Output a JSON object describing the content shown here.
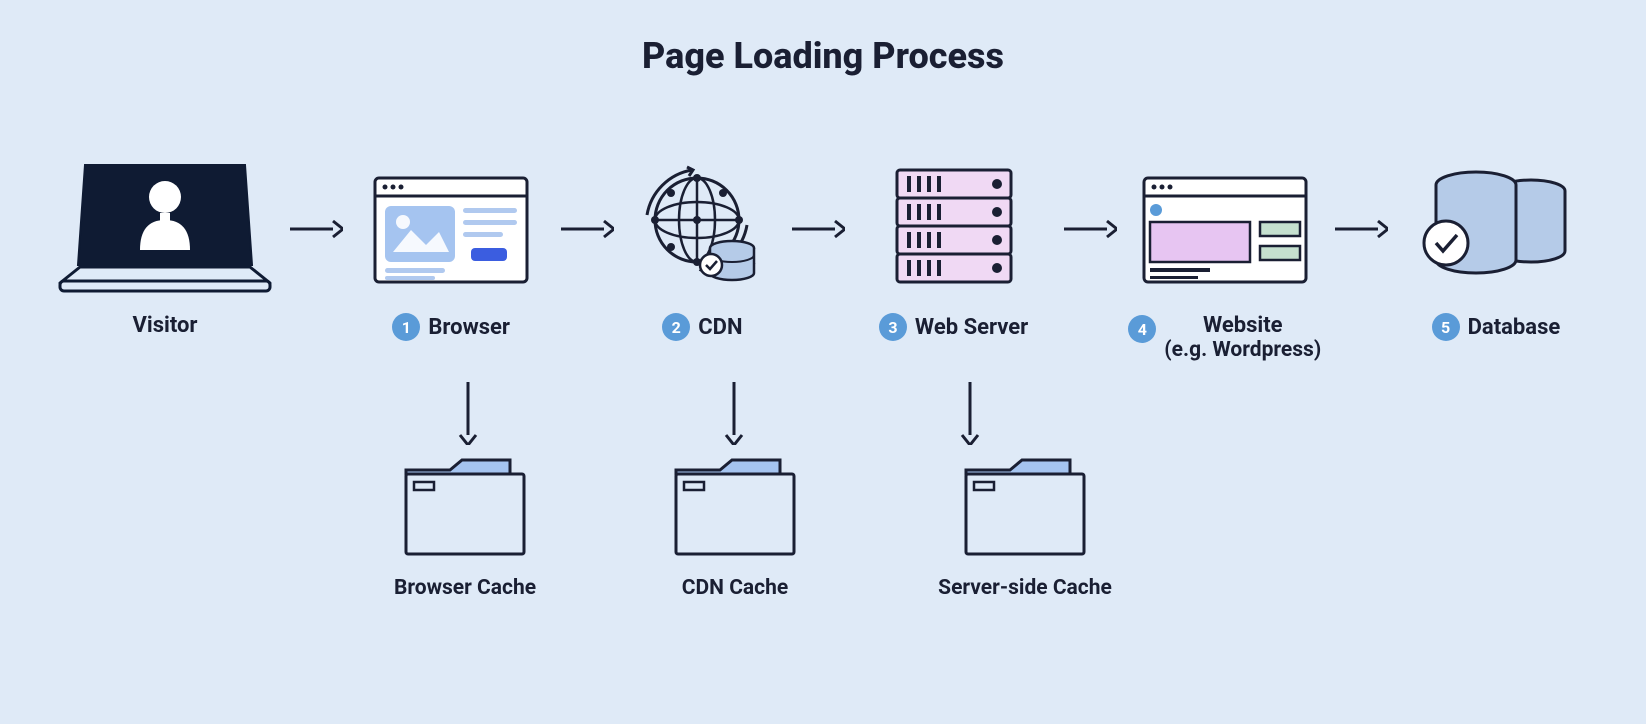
{
  "title": "Page Loading Process",
  "nodes": {
    "visitor": {
      "label": "Visitor"
    },
    "browser": {
      "num": "1",
      "label": "Browser"
    },
    "cdn": {
      "num": "2",
      "label": "CDN"
    },
    "webserver": {
      "num": "3",
      "label": "Web Server"
    },
    "website": {
      "num": "4",
      "label": "Website",
      "sublabel": "(e.g. Wordpress)"
    },
    "database": {
      "num": "5",
      "label": "Database"
    }
  },
  "caches": {
    "browser": {
      "label": "Browser Cache"
    },
    "cdn": {
      "label": "CDN  Cache"
    },
    "server": {
      "label": "Server-side Cache"
    }
  }
}
